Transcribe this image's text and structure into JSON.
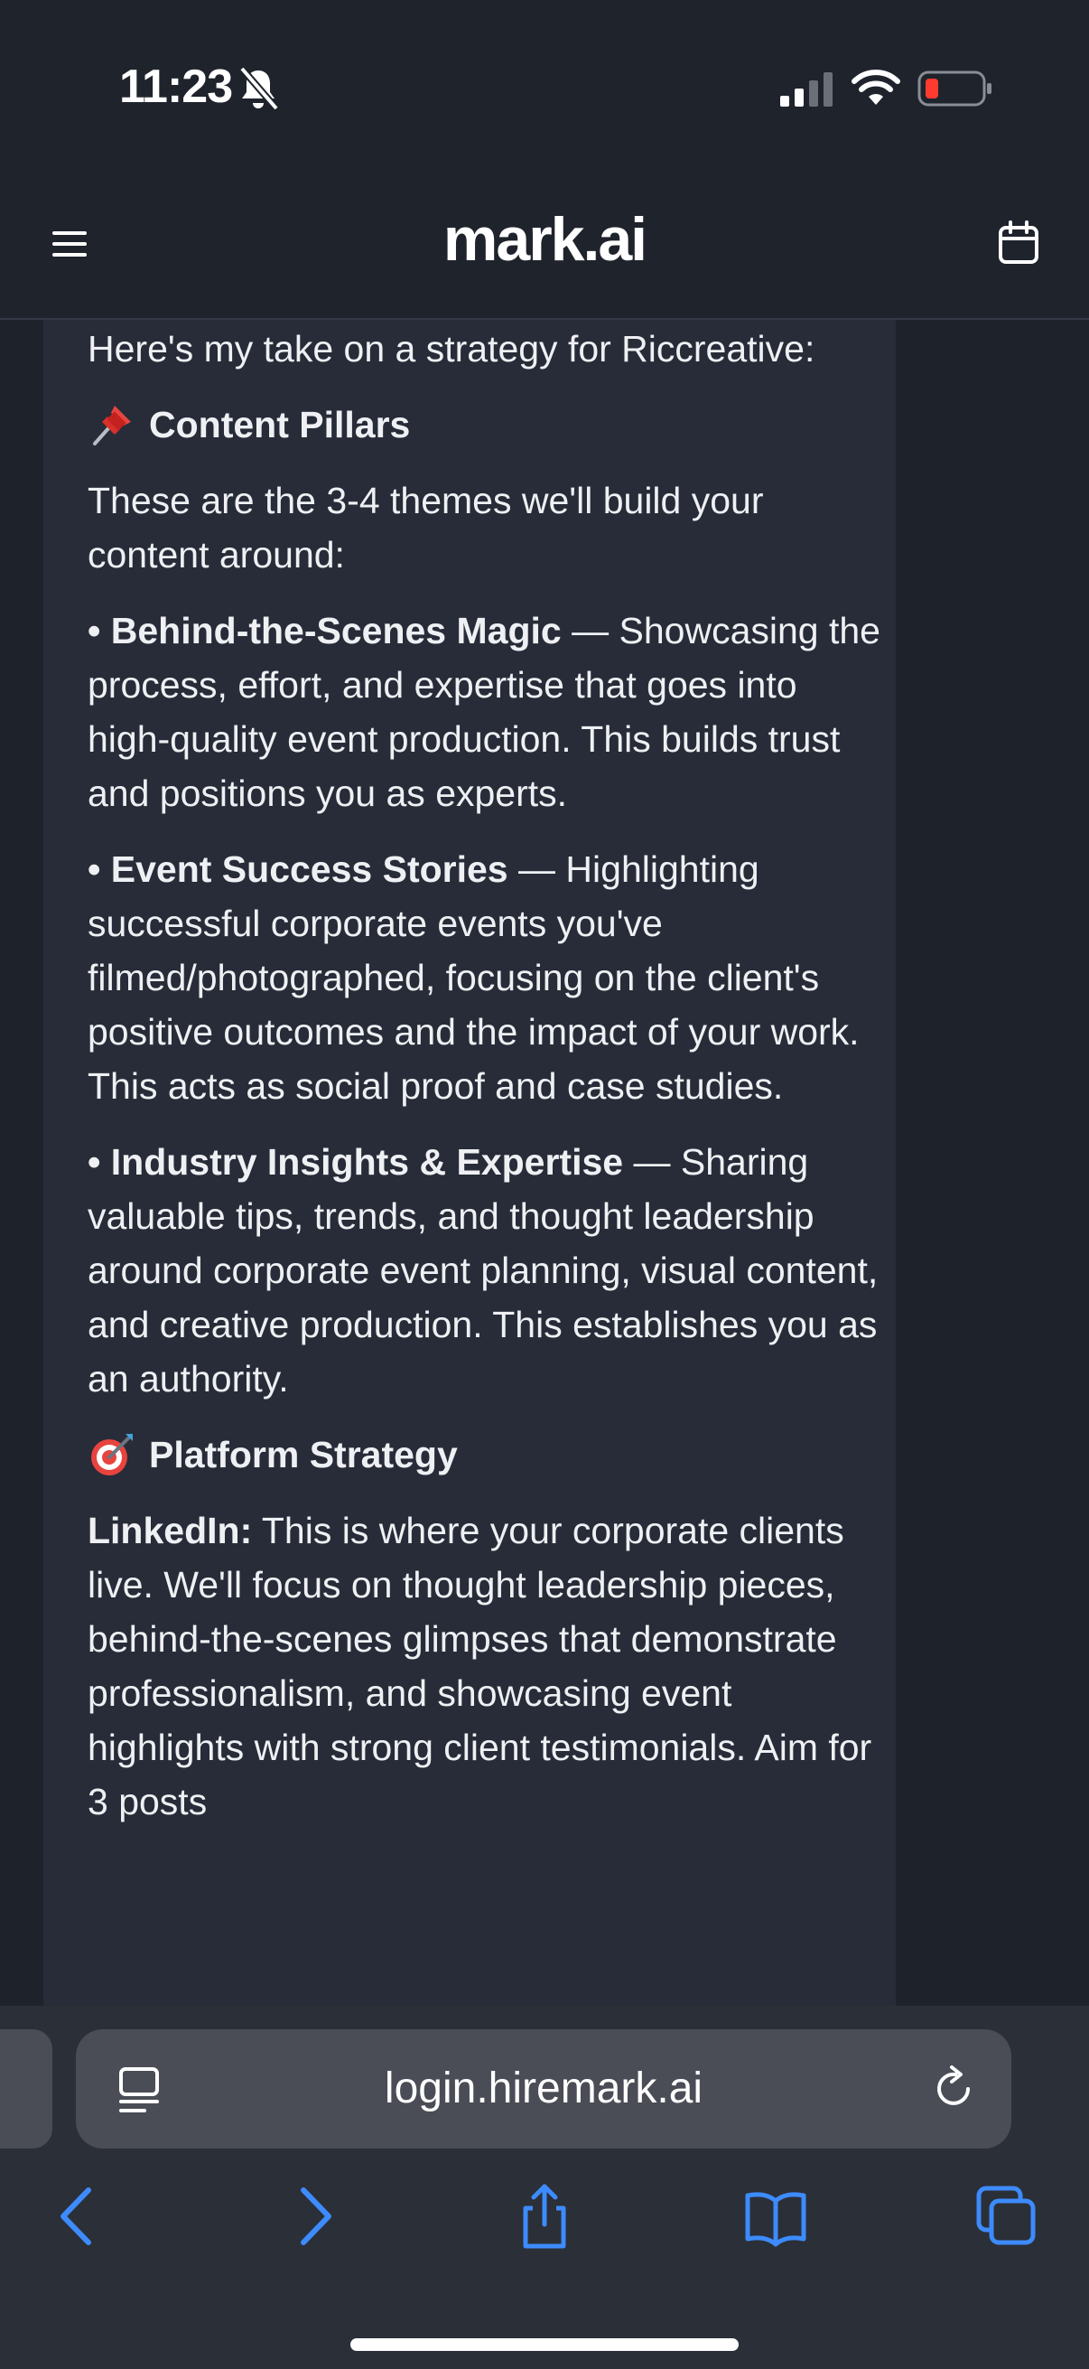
{
  "status_bar": {
    "time": "11:23"
  },
  "header": {
    "brand": "mark.ai"
  },
  "message": {
    "intro": "Here's my take on a strategy for Riccreative:",
    "section1": {
      "title": "Content Pillars",
      "lead": "These are the 3-4 themes we'll build your content around:",
      "items": [
        {
          "bullet": "•",
          "title": "Behind-the-Scenes Magic",
          "dash": "—",
          "text": "Showcasing the process, effort, and expertise that goes into high-quality event production. This builds trust and positions you as experts."
        },
        {
          "bullet": "•",
          "title": "Event Success Stories",
          "dash": "—",
          "text": "Highlighting successful corporate events you've filmed/photographed, focusing on the client's positive outcomes and the impact of your work. This acts as social proof and case studies."
        },
        {
          "bullet": "•",
          "title": "Industry Insights & Expertise",
          "dash": "—",
          "text": "Sharing valuable tips, trends, and thought leadership around corporate event planning, visual content, and creative production. This establishes you as an authority."
        }
      ]
    },
    "section2": {
      "title": "Platform Strategy",
      "linkedin_label": "LinkedIn:",
      "linkedin_text": "This is where your corporate clients live. We'll focus on thought leadership pieces, behind-the-scenes glimpses that demonstrate professionalism, and showcasing event highlights with strong client testimonials. Aim for 3 posts"
    }
  },
  "browser": {
    "url": "login.hiremark.ai"
  },
  "colors": {
    "background": "#1e222b",
    "bubble": "#272c38",
    "accent_blue": "#3d8bfd",
    "battery_low": "#ff3b30"
  },
  "icons": {
    "menu": "hamburger-icon",
    "calendar": "calendar-icon",
    "reader": "reader-mode-icon",
    "reload": "reload-icon",
    "back": "back-chevron-icon",
    "forward": "forward-chevron-icon",
    "share": "share-icon",
    "bookmarks": "bookmarks-book-icon",
    "tabs": "tabs-icon"
  }
}
